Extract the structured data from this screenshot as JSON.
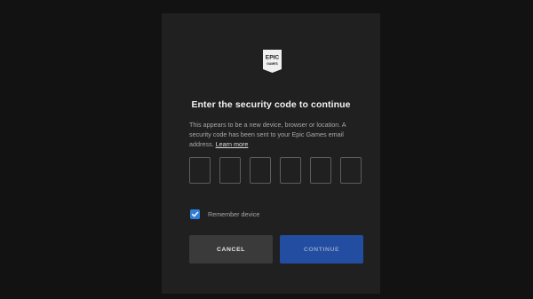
{
  "brand": {
    "logo_line1": "EPIC",
    "logo_line2": "GAMES",
    "logo_icon": "epic-games-logo"
  },
  "dialog": {
    "title": "Enter the security code to continue",
    "description": "This appears to be a new device, browser or location. A security code has been sent to your Epic Games email address.",
    "learn_more": "Learn more"
  },
  "code_inputs": [
    "",
    "",
    "",
    "",
    "",
    ""
  ],
  "remember": {
    "label": "Remember device",
    "checked": true
  },
  "buttons": {
    "cancel": "CANCEL",
    "continue": "CONTINUE"
  },
  "colors": {
    "background": "#121212",
    "card": "#202020",
    "accent": "#2f7fd8",
    "continue_button": "#234da0"
  }
}
